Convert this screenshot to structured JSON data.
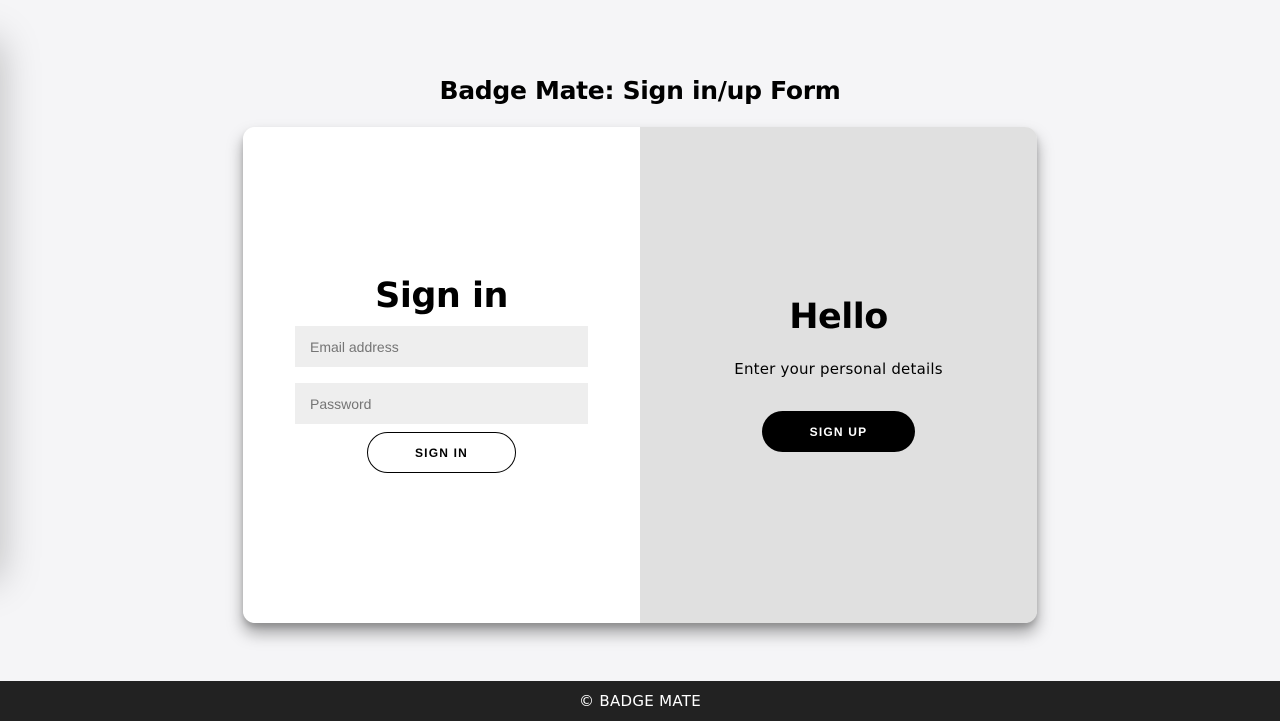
{
  "page": {
    "title": "Badge Mate: Sign in/up Form"
  },
  "signin": {
    "heading": "Sign in",
    "email_placeholder": "Email address",
    "password_placeholder": "Password",
    "button_label": "SIGN IN"
  },
  "signup_panel": {
    "heading": "Hello",
    "subtitle": "Enter your personal details",
    "button_label": "SIGN UP"
  },
  "footer": {
    "text": "© BADGE MATE"
  },
  "colors": {
    "page_background": "#f5f5f7",
    "card_left": "#ffffff",
    "card_right": "#e0e0e0",
    "input_background": "#eeeeee",
    "primary_button": "#000000",
    "footer_background": "#222222"
  }
}
